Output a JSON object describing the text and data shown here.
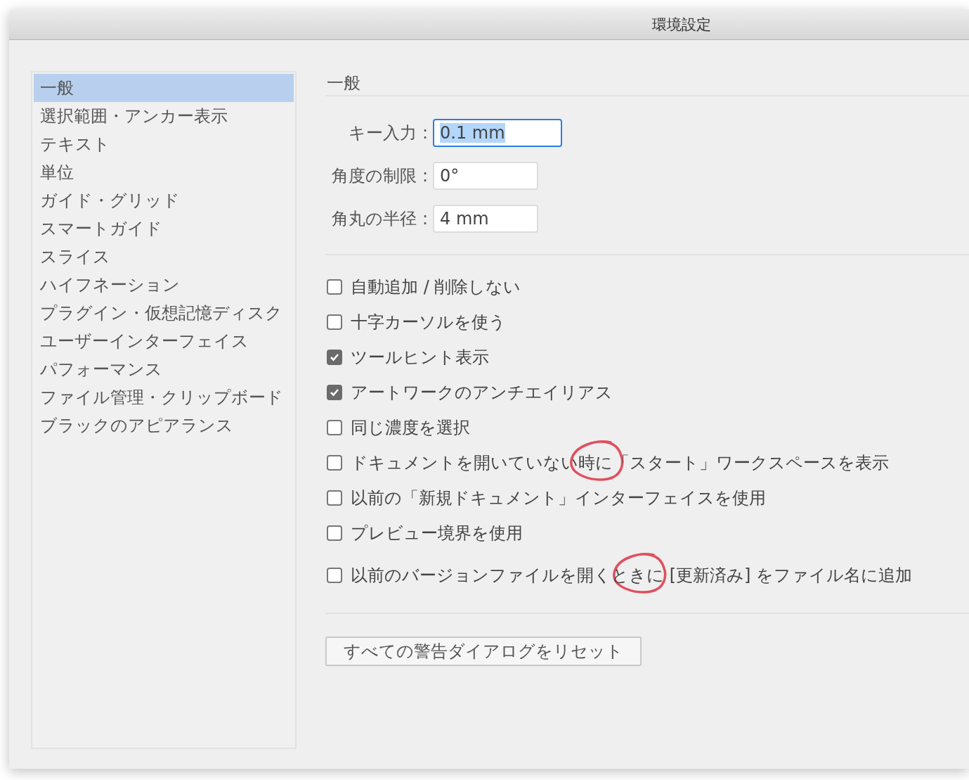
{
  "window": {
    "title": "環境設定"
  },
  "sidebar": {
    "items": [
      {
        "label": "一般",
        "selected": true
      },
      {
        "label": "選択範囲・アンカー表示",
        "selected": false
      },
      {
        "label": "テキスト",
        "selected": false
      },
      {
        "label": "単位",
        "selected": false
      },
      {
        "label": "ガイド・グリッド",
        "selected": false
      },
      {
        "label": "スマートガイド",
        "selected": false
      },
      {
        "label": "スライス",
        "selected": false
      },
      {
        "label": "ハイフネーション",
        "selected": false
      },
      {
        "label": "プラグイン・仮想記憶ディスク",
        "selected": false
      },
      {
        "label": "ユーザーインターフェイス",
        "selected": false
      },
      {
        "label": "パフォーマンス",
        "selected": false
      },
      {
        "label": "ファイル管理・クリップボード",
        "selected": false
      },
      {
        "label": "ブラックのアピアランス",
        "selected": false
      }
    ]
  },
  "section_title": "一般",
  "fields": [
    {
      "label": "キー入力 :",
      "value": "0.1 mm",
      "focused": true
    },
    {
      "label": "角度の制限 :",
      "value": "0°",
      "focused": false
    },
    {
      "label": "角丸の半径 :",
      "value": "4 mm",
      "focused": false
    }
  ],
  "options": [
    {
      "label": "自動追加 / 削除しない",
      "checked": false,
      "annotated": false
    },
    {
      "label": "十字カーソルを使う",
      "checked": false,
      "annotated": false
    },
    {
      "label": "ツールヒント表示",
      "checked": true,
      "annotated": false
    },
    {
      "label": "アートワークのアンチエイリアス",
      "checked": true,
      "annotated": false
    },
    {
      "label": "同じ濃度を選択",
      "checked": false,
      "annotated": false
    },
    {
      "label": "ドキュメントを開いていない時に「スタート」ワークスペースを表示",
      "checked": false,
      "annotated": true
    },
    {
      "label": "以前の「新規ドキュメント」インターフェイスを使用",
      "checked": false,
      "annotated": false
    },
    {
      "label": "プレビュー境界を使用",
      "checked": false,
      "annotated": false
    },
    {
      "label": "以前のバージョンファイルを開くときに [更新済み] をファイル名に追加",
      "checked": false,
      "annotated": true
    }
  ],
  "reset_button": "すべての警告ダイアログをリセット"
}
